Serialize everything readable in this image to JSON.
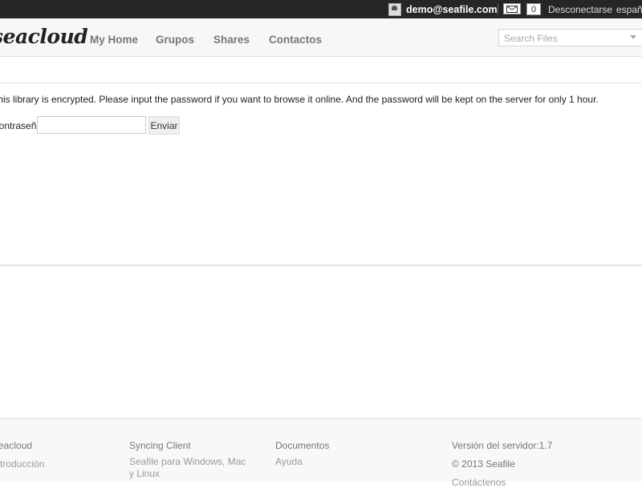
{
  "topbar": {
    "user_email": "demo@seafile.com",
    "unread_count": "0",
    "logout_label": "Desconectarse",
    "language_label": "españ"
  },
  "header": {
    "logo_text": "seacloud",
    "nav": [
      {
        "label": "My Home"
      },
      {
        "label": "Grupos"
      },
      {
        "label": "Shares"
      },
      {
        "label": "Contactos"
      }
    ],
    "search_placeholder": "Search Files"
  },
  "main": {
    "message": "This library is encrypted. Please input the password if you want to browse it online. And the password will be kept on the server for only 1 hour.",
    "password_label": "Contraseña:",
    "password_value": "",
    "submit_label": "Enviar"
  },
  "footer": {
    "col1": {
      "title": "Seacloud",
      "link": "Introducción"
    },
    "col2": {
      "title": "Syncing Client",
      "link": "Seafile para Windows, Mac y Linux"
    },
    "col3": {
      "title": "Documentos",
      "link": "Ayuda"
    },
    "col4": {
      "version": "Versión del servidor:1.7",
      "copyright": "© 2013 Seafile",
      "contact": "Contáctenos"
    }
  },
  "colors": {
    "topbar_bg": "#262626",
    "header_bg": "#f7f7f7",
    "nav_text": "#777777",
    "footer_bg": "#f8f8f8"
  },
  "icons": [
    "user-avatar-icon",
    "mail-icon",
    "search-caret-icon"
  ]
}
